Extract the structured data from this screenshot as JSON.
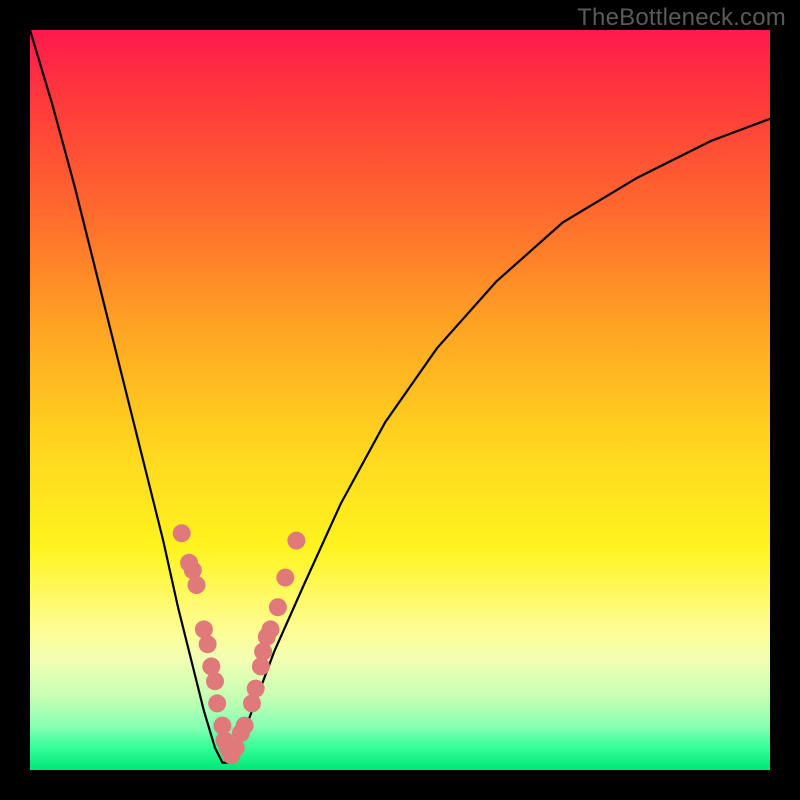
{
  "watermark": "TheBottleneck.com",
  "chart_data": {
    "type": "line",
    "title": "",
    "xlabel": "",
    "ylabel": "",
    "xlim": [
      0,
      1
    ],
    "ylim": [
      0,
      1
    ],
    "series": [
      {
        "name": "bottleneck-curve",
        "x": [
          0.0,
          0.03,
          0.06,
          0.09,
          0.12,
          0.15,
          0.18,
          0.2,
          0.22,
          0.235,
          0.25,
          0.26,
          0.27,
          0.285,
          0.3,
          0.33,
          0.37,
          0.42,
          0.48,
          0.55,
          0.63,
          0.72,
          0.82,
          0.92,
          1.0
        ],
        "y": [
          1.0,
          0.9,
          0.79,
          0.67,
          0.55,
          0.43,
          0.31,
          0.22,
          0.14,
          0.08,
          0.03,
          0.01,
          0.01,
          0.04,
          0.08,
          0.16,
          0.25,
          0.36,
          0.47,
          0.57,
          0.66,
          0.74,
          0.8,
          0.85,
          0.88
        ]
      }
    ],
    "scatter_points": {
      "name": "data-points",
      "points": [
        {
          "x": 0.205,
          "y": 0.32
        },
        {
          "x": 0.215,
          "y": 0.28
        },
        {
          "x": 0.22,
          "y": 0.27
        },
        {
          "x": 0.225,
          "y": 0.25
        },
        {
          "x": 0.235,
          "y": 0.19
        },
        {
          "x": 0.24,
          "y": 0.17
        },
        {
          "x": 0.245,
          "y": 0.14
        },
        {
          "x": 0.25,
          "y": 0.12
        },
        {
          "x": 0.253,
          "y": 0.09
        },
        {
          "x": 0.26,
          "y": 0.06
        },
        {
          "x": 0.263,
          "y": 0.04
        },
        {
          "x": 0.267,
          "y": 0.03
        },
        {
          "x": 0.272,
          "y": 0.02
        },
        {
          "x": 0.278,
          "y": 0.03
        },
        {
          "x": 0.285,
          "y": 0.05
        },
        {
          "x": 0.29,
          "y": 0.06
        },
        {
          "x": 0.3,
          "y": 0.09
        },
        {
          "x": 0.305,
          "y": 0.11
        },
        {
          "x": 0.312,
          "y": 0.14
        },
        {
          "x": 0.315,
          "y": 0.16
        },
        {
          "x": 0.32,
          "y": 0.18
        },
        {
          "x": 0.325,
          "y": 0.19
        },
        {
          "x": 0.335,
          "y": 0.22
        },
        {
          "x": 0.345,
          "y": 0.26
        },
        {
          "x": 0.36,
          "y": 0.31
        }
      ]
    },
    "background_gradient": [
      {
        "stop": 0.0,
        "color": "#ff1a4d"
      },
      {
        "stop": 0.55,
        "color": "#ffd21f"
      },
      {
        "stop": 0.85,
        "color": "#f2ffb3"
      },
      {
        "stop": 1.0,
        "color": "#00e676"
      }
    ]
  }
}
